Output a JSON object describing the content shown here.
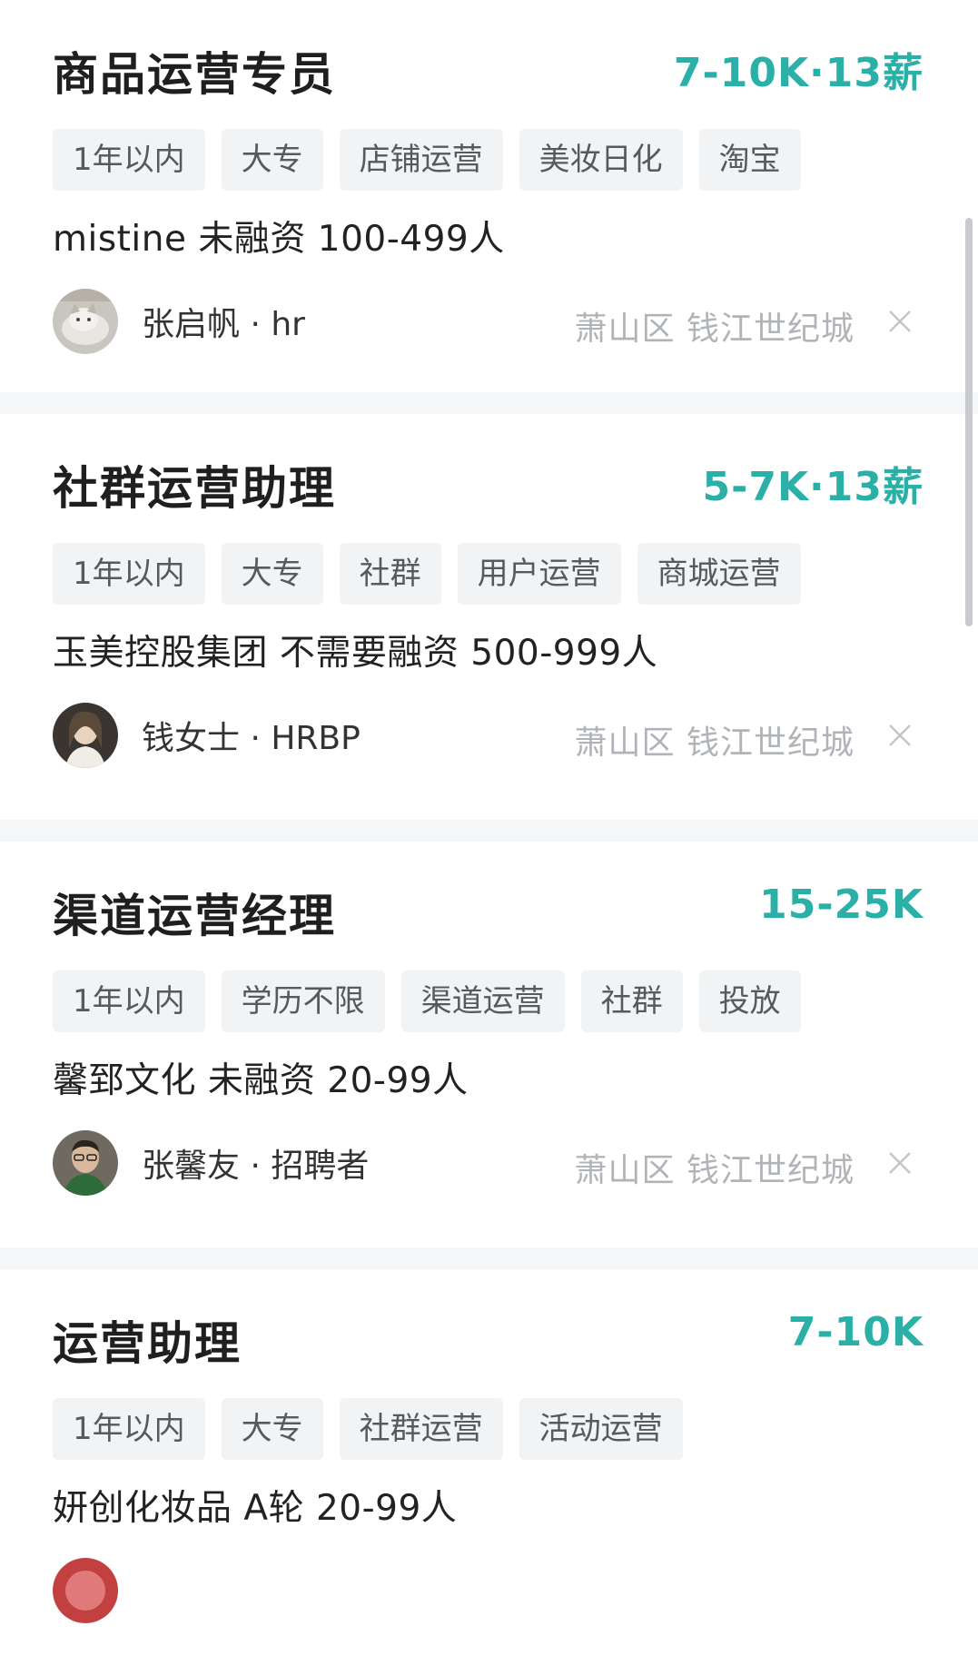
{
  "jobs": [
    {
      "title": "商品运营专员",
      "salary": "7-10K·13薪",
      "tags": [
        "1年以内",
        "大专",
        "店铺运营",
        "美妆日化",
        "淘宝"
      ],
      "company": "mistine 未融资 100-499人",
      "recruiter": "张启帆 · hr",
      "location": "萧山区  钱江世纪城"
    },
    {
      "title": "社群运营助理",
      "salary": "5-7K·13薪",
      "tags": [
        "1年以内",
        "大专",
        "社群",
        "用户运营",
        "商城运营"
      ],
      "company": "玉美控股集团 不需要融资 500-999人",
      "recruiter": "钱女士 · HRBP",
      "location": "萧山区  钱江世纪城"
    },
    {
      "title": "渠道运营经理",
      "salary": "15-25K",
      "tags": [
        "1年以内",
        "学历不限",
        "渠道运营",
        "社群",
        "投放"
      ],
      "company": "馨郅文化 未融资 20-99人",
      "recruiter": "张馨友 · 招聘者",
      "location": "萧山区  钱江世纪城"
    },
    {
      "title": "运营助理",
      "salary": "7-10K",
      "tags": [
        "1年以内",
        "大专",
        "社群运营",
        "活动运营"
      ],
      "company": "妍创化妆品 A轮 20-99人"
    }
  ],
  "theme": {
    "salary_color": "#2bb0a7",
    "tag_bg": "#f2f3f5",
    "divider_bg": "#f5f6f7"
  }
}
